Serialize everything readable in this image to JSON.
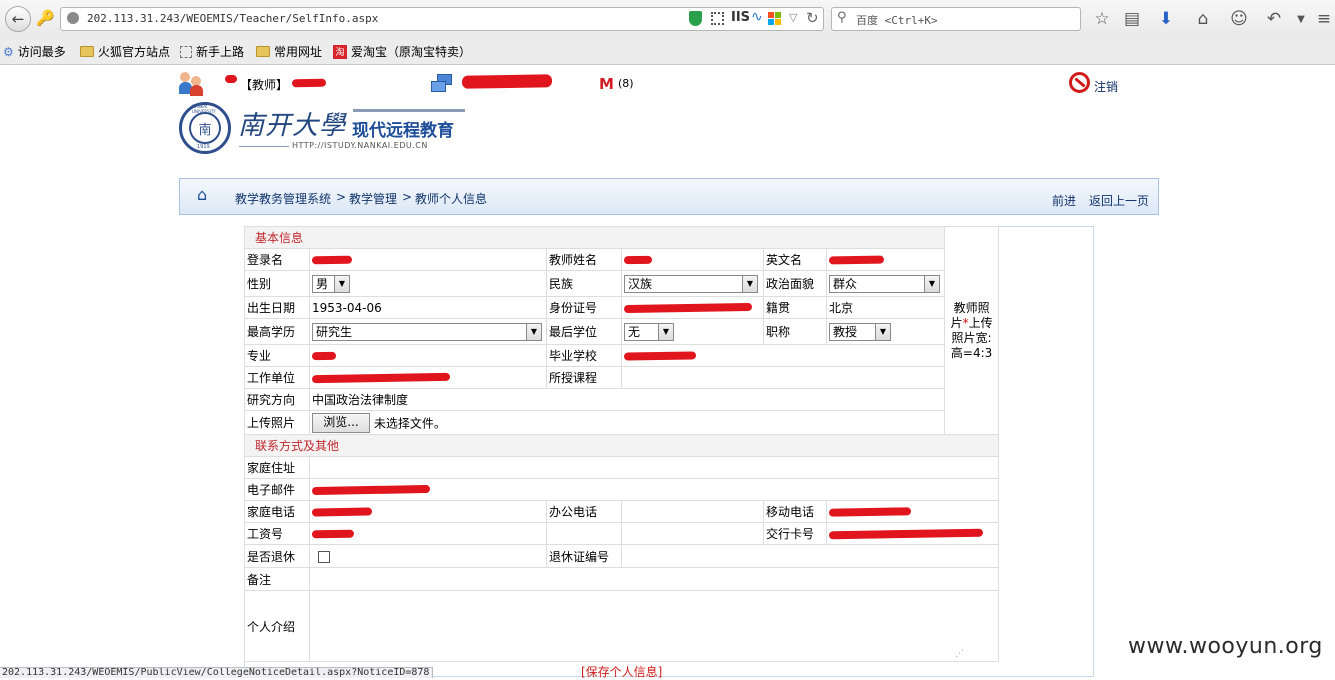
{
  "browser": {
    "url": "202.113.31.243/WEOEMIS/Teacher/SelfInfo.aspx",
    "search_placeholder": "百度 <Ctrl+K>",
    "iis_label": "IIS",
    "bookmarks": [
      "访问最多",
      "火狐官方站点",
      "新手上路",
      "常用网址",
      "爱淘宝（原淘宝特卖）"
    ]
  },
  "header": {
    "role_label": "【教师】",
    "mail_count": "(8)",
    "logout_label": "注销"
  },
  "logo": {
    "cn_name": "南开大學",
    "program": "现代远程教育",
    "url": "HTTP://ISTUDY.NANKAI.EDU.CN",
    "seal_text": "NANKAI UNIVERSITY",
    "seal_year": "1919"
  },
  "breadcrumb": {
    "items": [
      "教学教务管理系统",
      "教学管理",
      "教师个人信息"
    ],
    "separator": ">",
    "forward_label": "前进",
    "back_label": "返回上一页"
  },
  "basic": {
    "section_title": "基本信息",
    "login_label": "登录名",
    "name_label": "教师姓名",
    "english_name_label": "英文名",
    "gender_label": "性别",
    "gender_value": "男",
    "ethnicity_label": "民族",
    "ethnicity_value": "汉族",
    "political_label": "政治面貌",
    "political_value": "群众",
    "birth_label": "出生日期",
    "birth_value": "1953-04-06",
    "id_label": "身份证号",
    "native_label": "籍贯",
    "native_value": "北京",
    "education_label": "最高学历",
    "education_value": "研究生",
    "degree_label": "最后学位",
    "degree_value": "无",
    "title_label": "职称",
    "title_value": "教授",
    "major_label": "专业",
    "school_label": "毕业学校",
    "employer_label": "工作单位",
    "courses_label": "所授课程",
    "research_label": "研究方向",
    "research_value": "中国政治法律制度",
    "upload_label": "上传照片",
    "browse_label": "浏览...",
    "no_file_label": "未选择文件。",
    "photo_label": "教师照片",
    "photo_required": "*",
    "photo_hint": "上传照片宽:高=4:3"
  },
  "contact": {
    "section_title": "联系方式及其他",
    "address_label": "家庭住址",
    "email_label": "电子邮件",
    "home_phone_label": "家庭电话",
    "office_phone_label": "办公电话",
    "mobile_label": "移动电话",
    "salary_no_label": "工资号",
    "bank_card_label": "交行卡号",
    "retired_label": "是否退休",
    "retire_cert_label": "退休证编号",
    "notes_label": "备注",
    "bio_label": "个人介绍"
  },
  "actions": {
    "save_label": "[保存个人信息]"
  },
  "status_bar": {
    "link": "202.113.31.243/WEOEMIS/PublicView/CollegeNoticeDetail.aspx?NoticeID=878"
  },
  "watermark": "www.wooyun.org",
  "colors": {
    "section_title": "#c0272d",
    "breadcrumb_text": "#12356b",
    "redaction": "#e0151d"
  }
}
